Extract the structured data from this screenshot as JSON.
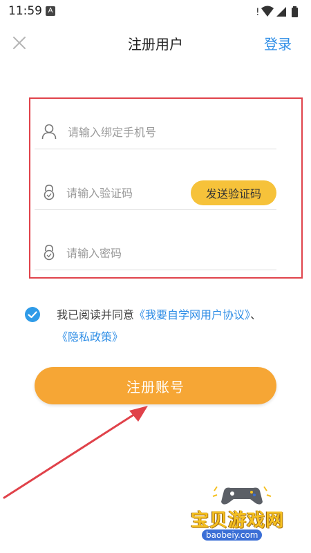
{
  "status_bar": {
    "time": "11:59",
    "notification_badge": "A",
    "icons": [
      "alert-icon",
      "wifi-icon",
      "signal-icon",
      "battery-icon"
    ]
  },
  "header": {
    "title": "注册用户",
    "login_label": "登录",
    "close_icon": "close-icon"
  },
  "form": {
    "phone": {
      "value": "",
      "placeholder": "请输入绑定手机号",
      "icon": "user-icon"
    },
    "code": {
      "value": "",
      "placeholder": "请输入验证码",
      "icon": "lock-icon",
      "send_label": "发送验证码"
    },
    "password": {
      "value": "",
      "placeholder": "请输入密码",
      "icon": "lock-icon"
    }
  },
  "agreement": {
    "checked": true,
    "prefix": "我已阅读并同意",
    "link_user": "《我要自学网用户协议》",
    "separator": "、",
    "link_privacy": "《隐私政策》"
  },
  "register_label": "注册账号",
  "watermark": {
    "name": "宝贝游戏网",
    "url": "baobeiy.com"
  },
  "colors": {
    "accent_blue": "#2f8ee6",
    "send_button": "#f6c23a",
    "register_button": "#f6a635",
    "highlight_border": "#e0424a"
  }
}
